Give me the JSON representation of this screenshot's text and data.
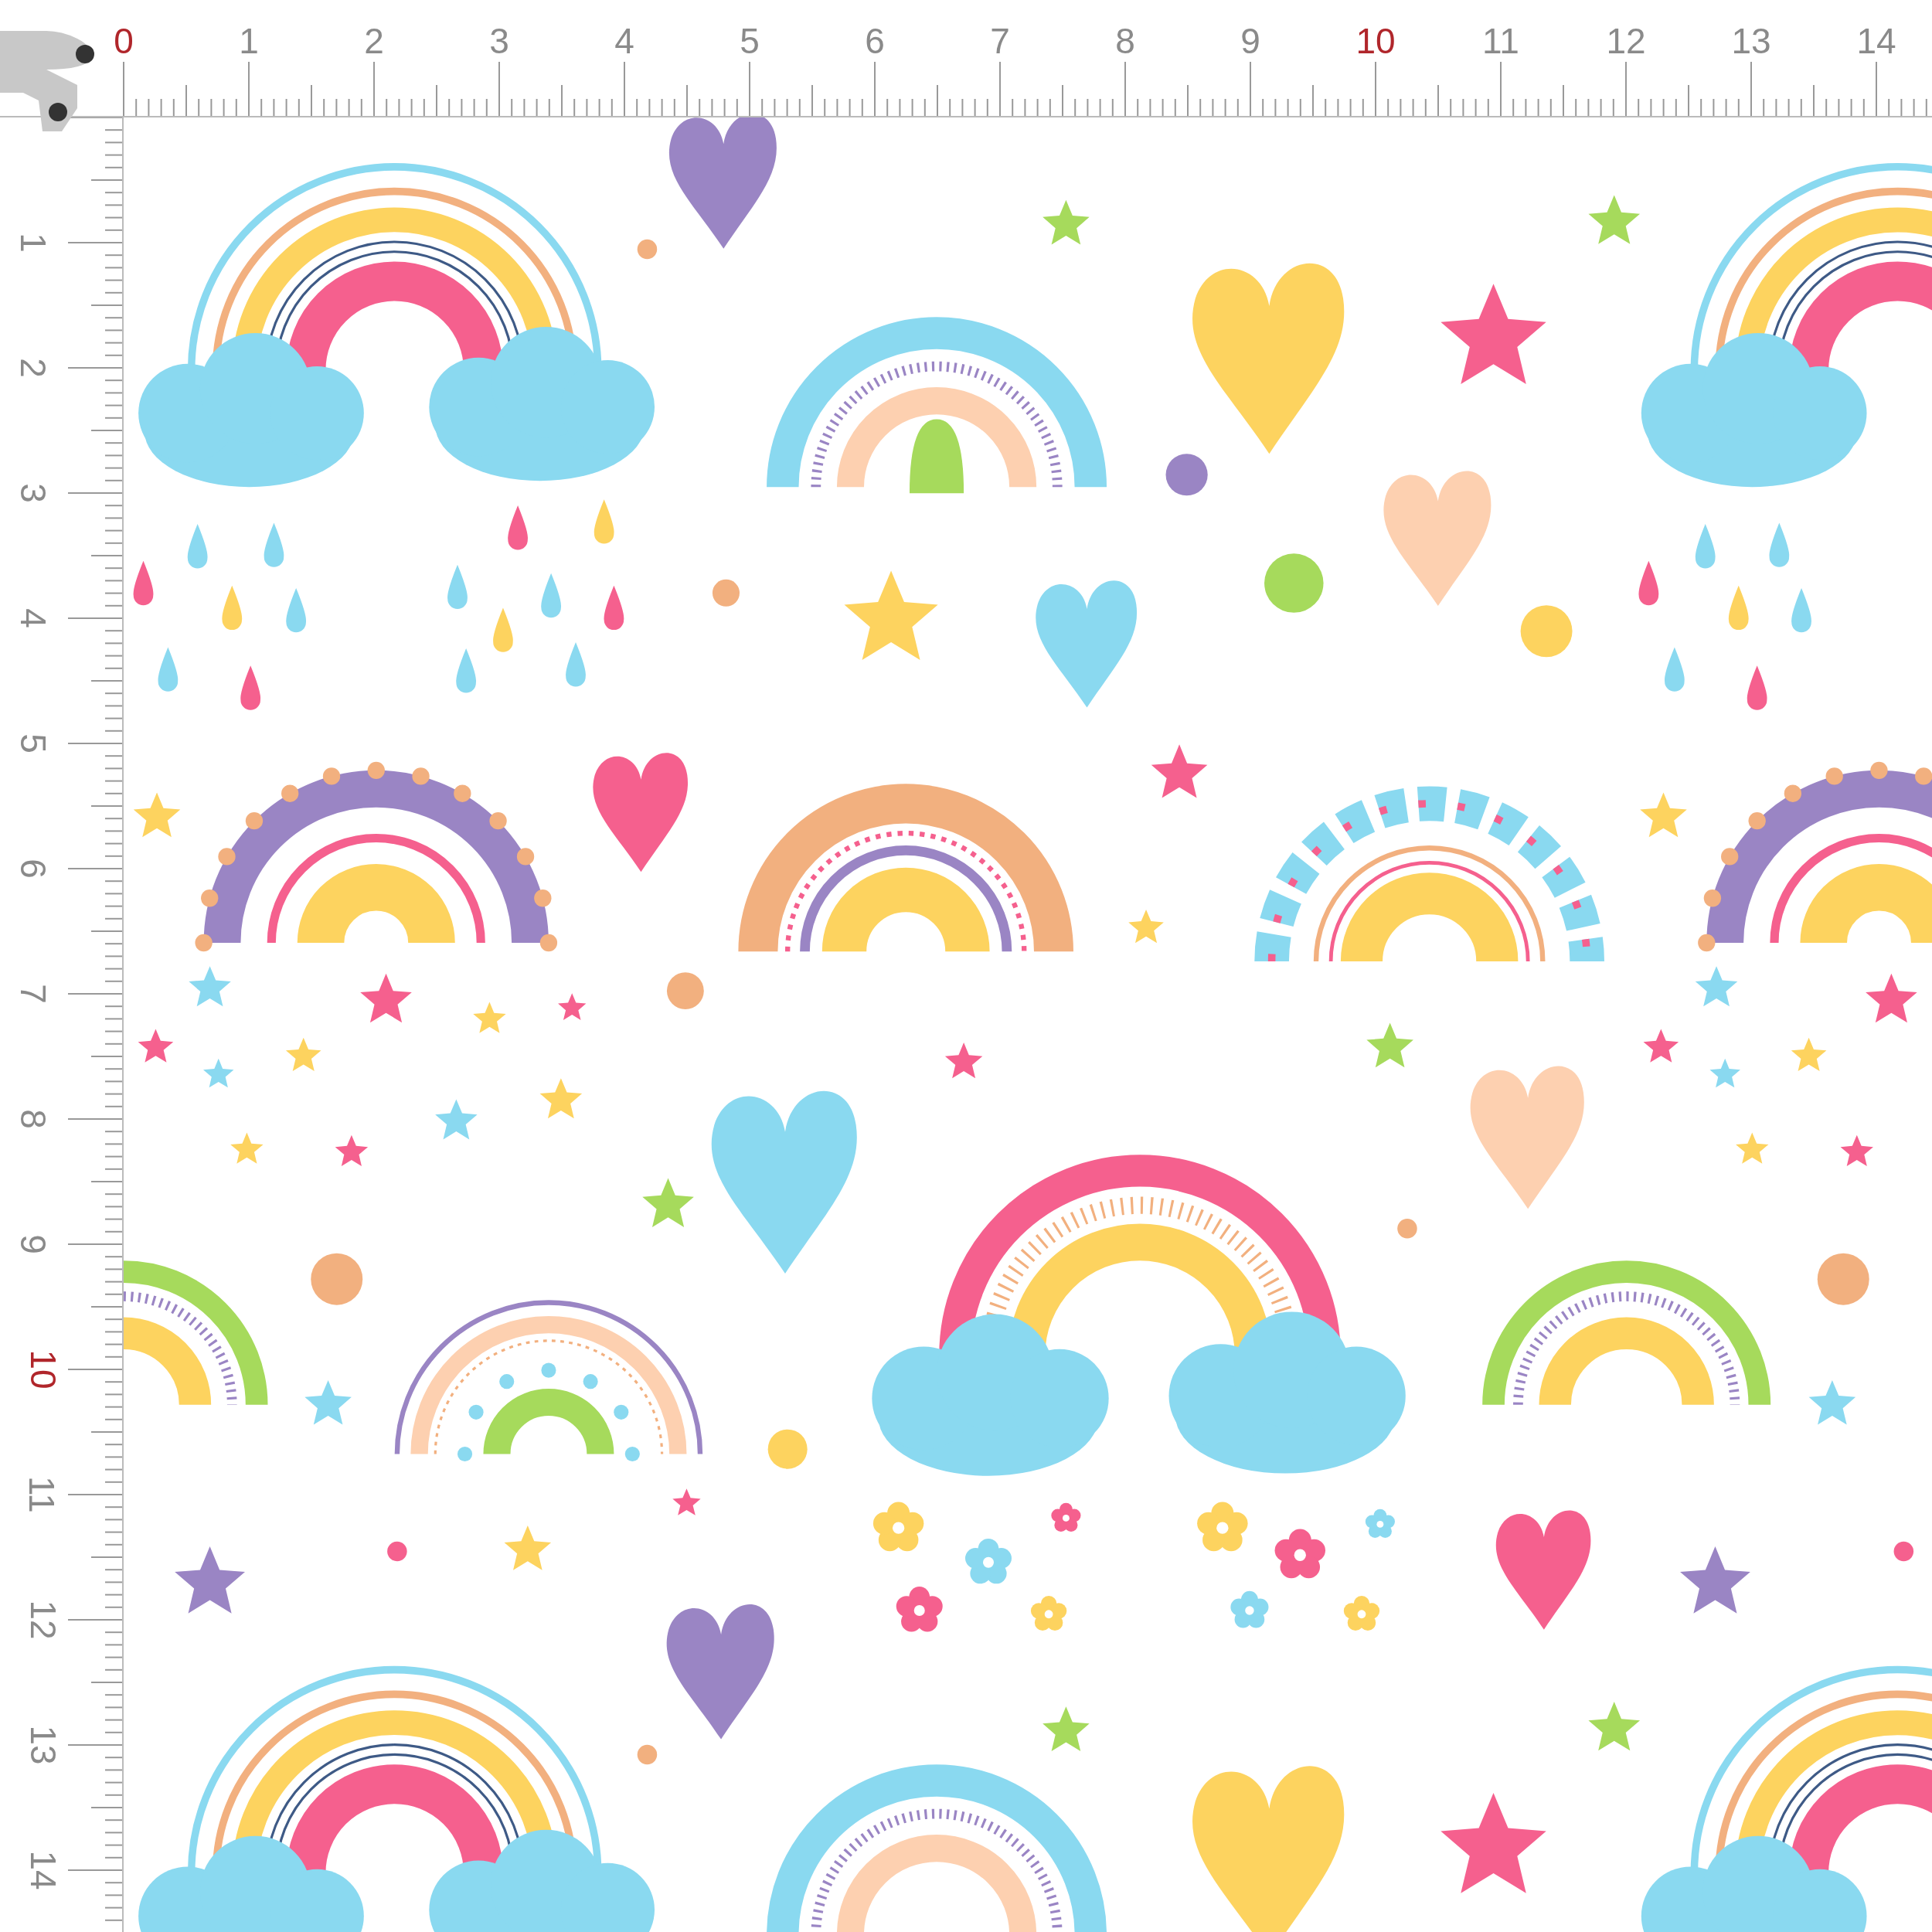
{
  "ruler_top": {
    "labels": [
      {
        "text": "0",
        "highlight": true
      },
      {
        "text": "1",
        "highlight": false
      },
      {
        "text": "2",
        "highlight": false
      },
      {
        "text": "3",
        "highlight": false
      },
      {
        "text": "4",
        "highlight": false
      },
      {
        "text": "5",
        "highlight": false
      },
      {
        "text": "6",
        "highlight": false
      },
      {
        "text": "7",
        "highlight": false
      },
      {
        "text": "8",
        "highlight": false
      },
      {
        "text": "9",
        "highlight": false
      },
      {
        "text": "10",
        "highlight": true
      },
      {
        "text": "11",
        "highlight": false
      },
      {
        "text": "12",
        "highlight": false
      },
      {
        "text": "13",
        "highlight": false
      },
      {
        "text": "14",
        "highlight": false
      }
    ]
  },
  "ruler_left": {
    "labels": [
      {
        "text": "1",
        "highlight": false
      },
      {
        "text": "2",
        "highlight": false
      },
      {
        "text": "3",
        "highlight": false
      },
      {
        "text": "4",
        "highlight": false
      },
      {
        "text": "5",
        "highlight": false
      },
      {
        "text": "6",
        "highlight": false
      },
      {
        "text": "7",
        "highlight": false
      },
      {
        "text": "8",
        "highlight": false
      },
      {
        "text": "9",
        "highlight": false
      },
      {
        "text": "10",
        "highlight": true
      },
      {
        "text": "11",
        "highlight": false
      },
      {
        "text": "12",
        "highlight": false
      },
      {
        "text": "13",
        "highlight": false
      },
      {
        "text": "14",
        "highlight": false
      }
    ]
  }
}
